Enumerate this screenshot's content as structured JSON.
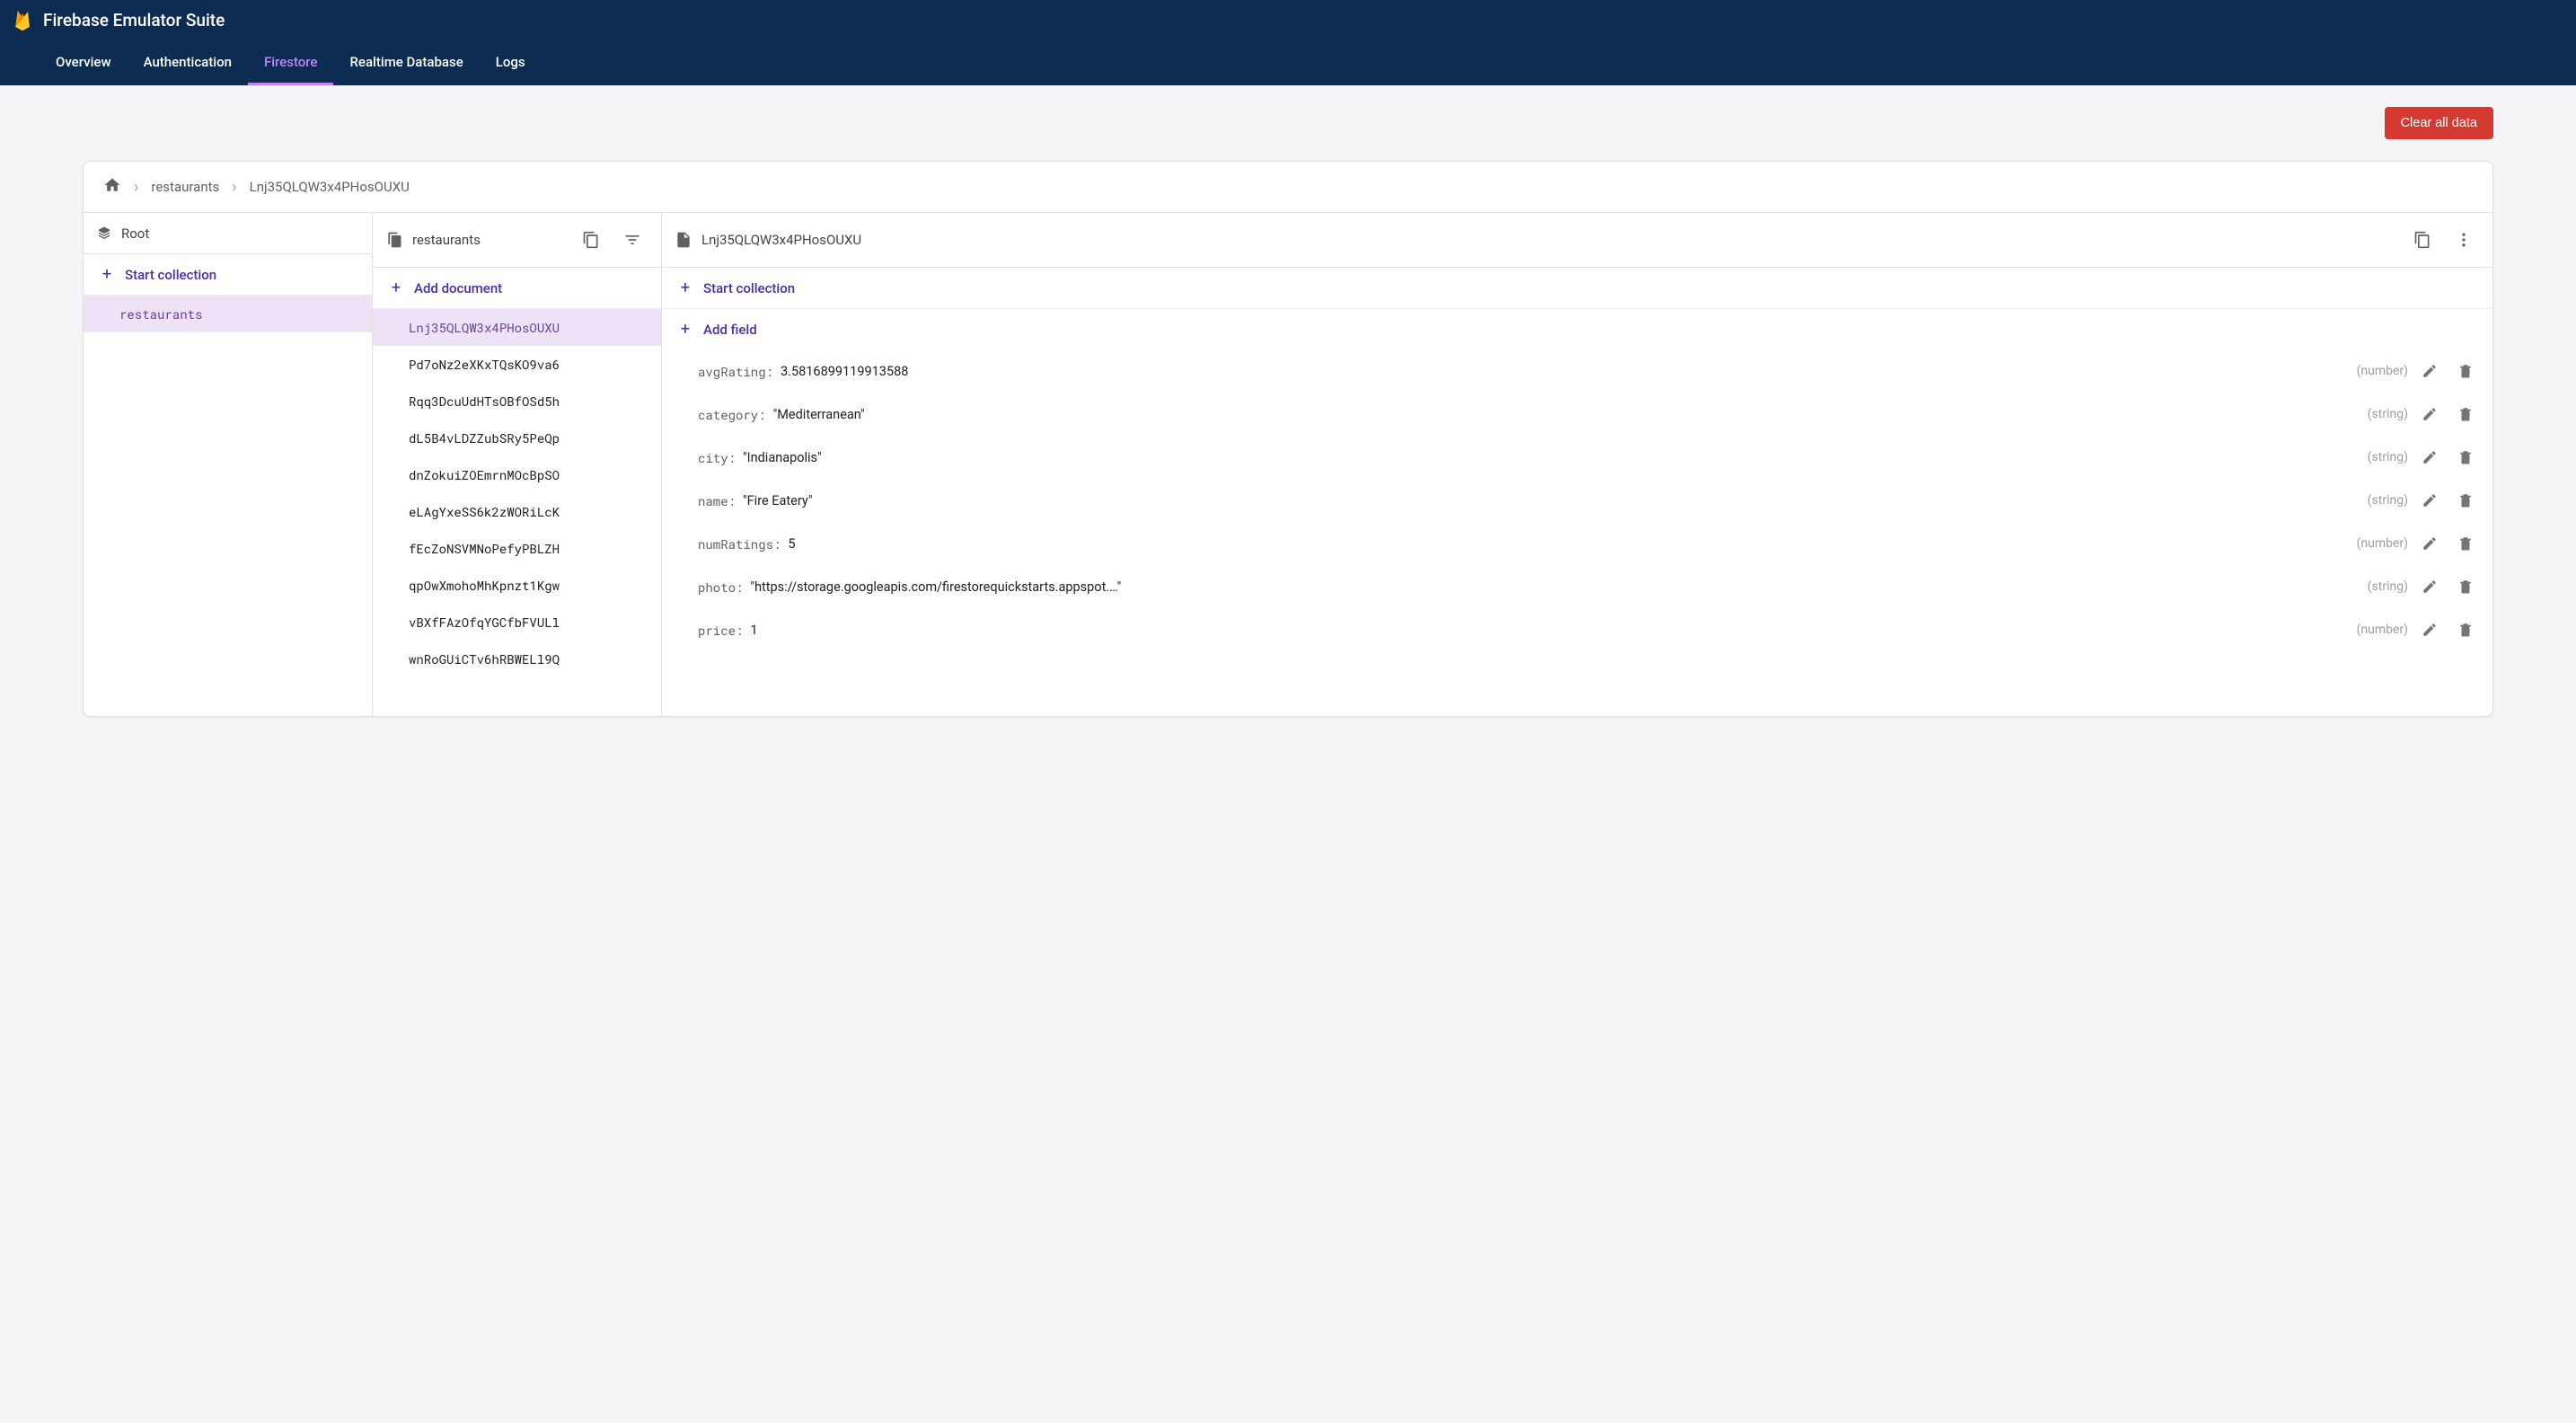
{
  "header": {
    "title": "Firebase Emulator Suite",
    "tabs": [
      {
        "label": "Overview",
        "active": false
      },
      {
        "label": "Authentication",
        "active": false
      },
      {
        "label": "Firestore",
        "active": true
      },
      {
        "label": "Realtime Database",
        "active": false
      },
      {
        "label": "Logs",
        "active": false
      }
    ]
  },
  "toolbar": {
    "clear_label": "Clear all data"
  },
  "breadcrumb": {
    "items": [
      "restaurants",
      "Lnj35QLQW3x4PHosOUXU"
    ]
  },
  "columns": {
    "root": {
      "title": "Root",
      "action": "Start collection",
      "items": [
        {
          "id": "restaurants",
          "selected": true
        }
      ]
    },
    "docs": {
      "title": "restaurants",
      "action": "Add document",
      "items": [
        {
          "id": "Lnj35QLQW3x4PHosOUXU",
          "selected": true
        },
        {
          "id": "Pd7oNz2eXKxTQsKO9va6"
        },
        {
          "id": "Rqq3DcuUdHTsOBfOSd5h"
        },
        {
          "id": "dL5B4vLDZZubSRy5PeQp"
        },
        {
          "id": "dnZokuiZOEmrnMOcBpSO"
        },
        {
          "id": "eLAgYxeSS6k2zWORiLcK"
        },
        {
          "id": "fEcZoNSVMNoPefyPBLZH"
        },
        {
          "id": "qpOwXmohoMhKpnzt1Kgw"
        },
        {
          "id": "vBXfFAzOfqYGCfbFVULl"
        },
        {
          "id": "wnRoGUiCTv6hRBWELl9Q"
        }
      ]
    },
    "detail": {
      "title": "Lnj35QLQW3x4PHosOUXU",
      "action_collection": "Start collection",
      "action_field": "Add field",
      "fields": [
        {
          "key": "avgRating",
          "value": "3.5816899119913588",
          "type": "number",
          "quoted": false
        },
        {
          "key": "category",
          "value": "Mediterranean",
          "type": "string",
          "quoted": true
        },
        {
          "key": "city",
          "value": "Indianapolis",
          "type": "string",
          "quoted": true
        },
        {
          "key": "name",
          "value": "Fire Eatery",
          "type": "string",
          "quoted": true
        },
        {
          "key": "numRatings",
          "value": "5",
          "type": "number",
          "quoted": false
        },
        {
          "key": "photo",
          "value": "https://storage.googleapis.com/firestorequickstarts.appspot.…",
          "type": "string",
          "quoted": true
        },
        {
          "key": "price",
          "value": "1",
          "type": "number",
          "quoted": false
        }
      ]
    }
  }
}
